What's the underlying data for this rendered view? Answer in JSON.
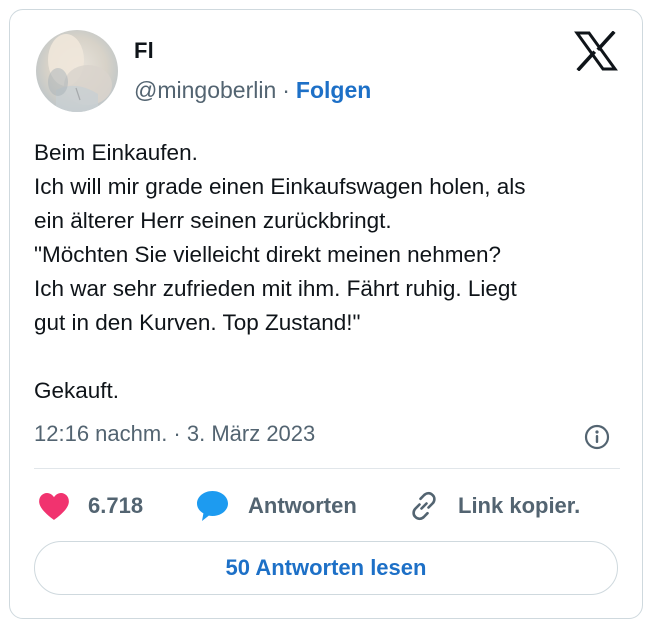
{
  "author": {
    "name": "Fl",
    "handle": "@mingoberlin",
    "separator": "·",
    "follow_label": "Folgen"
  },
  "tweet": {
    "lines": [
      "Beim Einkaufen.",
      "Ich will mir grade einen Einkaufswagen holen, als",
      "ein älterer Herr seinen zurückbringt.",
      "\"Möchten Sie vielleicht direkt meinen nehmen?",
      "Ich war sehr zufrieden mit ihm. Fährt ruhig. Liegt",
      "gut in den Kurven. Top Zustand!\"",
      "",
      "Gekauft."
    ],
    "timestamp": "12:16 nachm. · 3. März 2023"
  },
  "actions": {
    "like_count": "6.718",
    "reply_label": "Antworten",
    "copy_link_label": "Link kopier."
  },
  "read_replies_label": "50 Antworten lesen",
  "icons": {
    "logo": "x-logo-icon",
    "info": "info-icon",
    "like": "heart-icon",
    "reply": "speech-bubble-icon",
    "link": "link-icon"
  },
  "colors": {
    "accent": "#1d70c7",
    "like": "#f1336f",
    "reply": "#1d9bf0",
    "muted": "#536471",
    "text": "#0f1419",
    "border": "#cfd9de"
  }
}
